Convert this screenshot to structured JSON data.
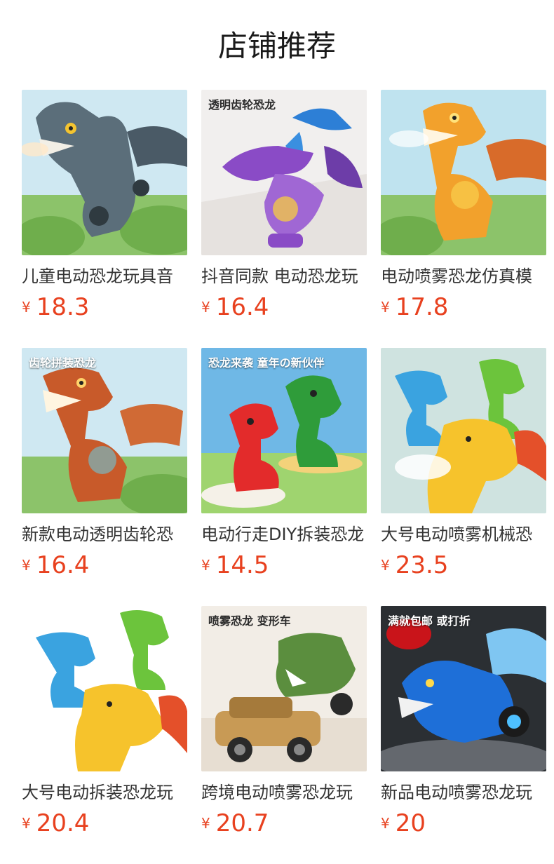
{
  "section_title": "店铺推荐",
  "currency": "¥",
  "products": [
    {
      "name": "儿童电动恐龙玩具音",
      "price": "18.3",
      "image_text": "",
      "theme": "grey-dino"
    },
    {
      "name": "抖音同款 电动恐龙玩",
      "price": "16.4",
      "image_text": "透明齿轮恐龙",
      "theme": "purple-ptero"
    },
    {
      "name": "电动喷雾恐龙仿真模",
      "price": "17.8",
      "image_text": "",
      "theme": "orange-dino"
    },
    {
      "name": "新款电动透明齿轮恐",
      "price": "16.4",
      "image_text": "齿轮拼装恐龙",
      "theme": "rust-dino"
    },
    {
      "name": "电动行走DIY拆装恐龙",
      "price": "14.5",
      "image_text": "恐龙来袭 童年の新伙伴",
      "theme": "red-green-dino"
    },
    {
      "name": "大号电动喷雾机械恐",
      "price": "23.5",
      "image_text": "",
      "theme": "three-dinos"
    },
    {
      "name": "大号电动拆装恐龙玩",
      "price": "20.4",
      "image_text": "",
      "theme": "three-dinos-white"
    },
    {
      "name": "跨境电动喷雾恐龙玩",
      "price": "20.7",
      "image_text": "喷雾恐龙 变形车",
      "theme": "dino-cars"
    },
    {
      "name": "新品电动喷雾恐龙玩",
      "price": "20",
      "image_text": "满就包邮 或打折",
      "theme": "blue-dragon"
    }
  ],
  "colors": {
    "price": "#e8411f",
    "title": "#1a1a1a",
    "name": "#333333"
  }
}
